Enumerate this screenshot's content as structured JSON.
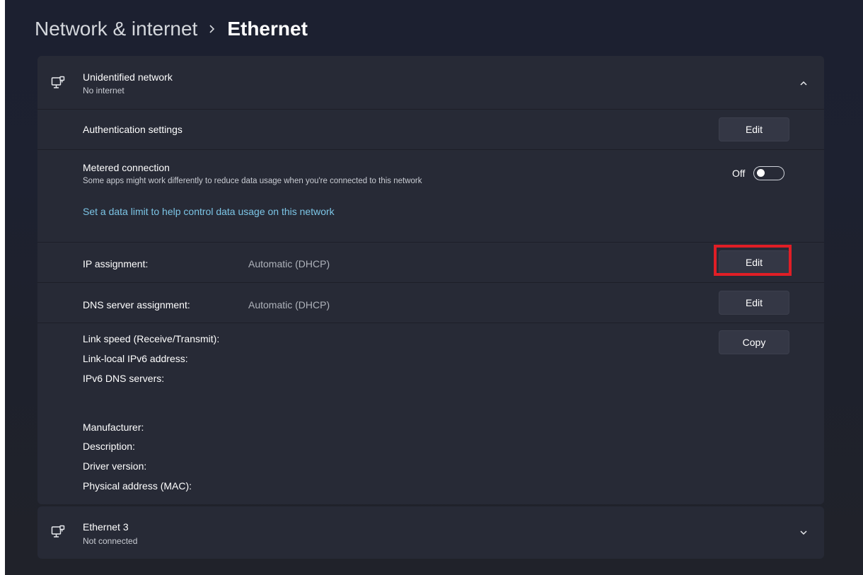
{
  "breadcrumb": {
    "parent": "Network & internet",
    "current": "Ethernet"
  },
  "network": {
    "name": "Unidentified network",
    "status": "No internet",
    "icon": "ethernet-icon",
    "expanded": true
  },
  "auth": {
    "label": "Authentication settings",
    "button": "Edit"
  },
  "metered": {
    "label": "Metered connection",
    "description": "Some apps might work differently to reduce data usage when you're connected to this network",
    "toggle_label": "Off",
    "toggle_on": false,
    "link": "Set a data limit to help control data usage on this network"
  },
  "ip": {
    "label": "IP assignment:",
    "value": "Automatic (DHCP)",
    "button": "Edit"
  },
  "dns": {
    "label": "DNS server assignment:",
    "value": "Automatic (DHCP)",
    "button": "Edit"
  },
  "properties": {
    "link_speed": "Link speed (Receive/Transmit):",
    "ipv6_local": "Link-local IPv6 address:",
    "ipv6_dns": "IPv6 DNS servers:",
    "manufacturer": "Manufacturer:",
    "description": "Description:",
    "driver": "Driver version:",
    "mac": "Physical address (MAC):",
    "button": "Copy"
  },
  "ethernet3": {
    "name": "Ethernet 3",
    "status": "Not connected",
    "icon": "ethernet-icon",
    "expanded": false
  },
  "colors": {
    "highlight": "#e01e26",
    "link": "#7cc5e6",
    "card": "#272a36"
  }
}
